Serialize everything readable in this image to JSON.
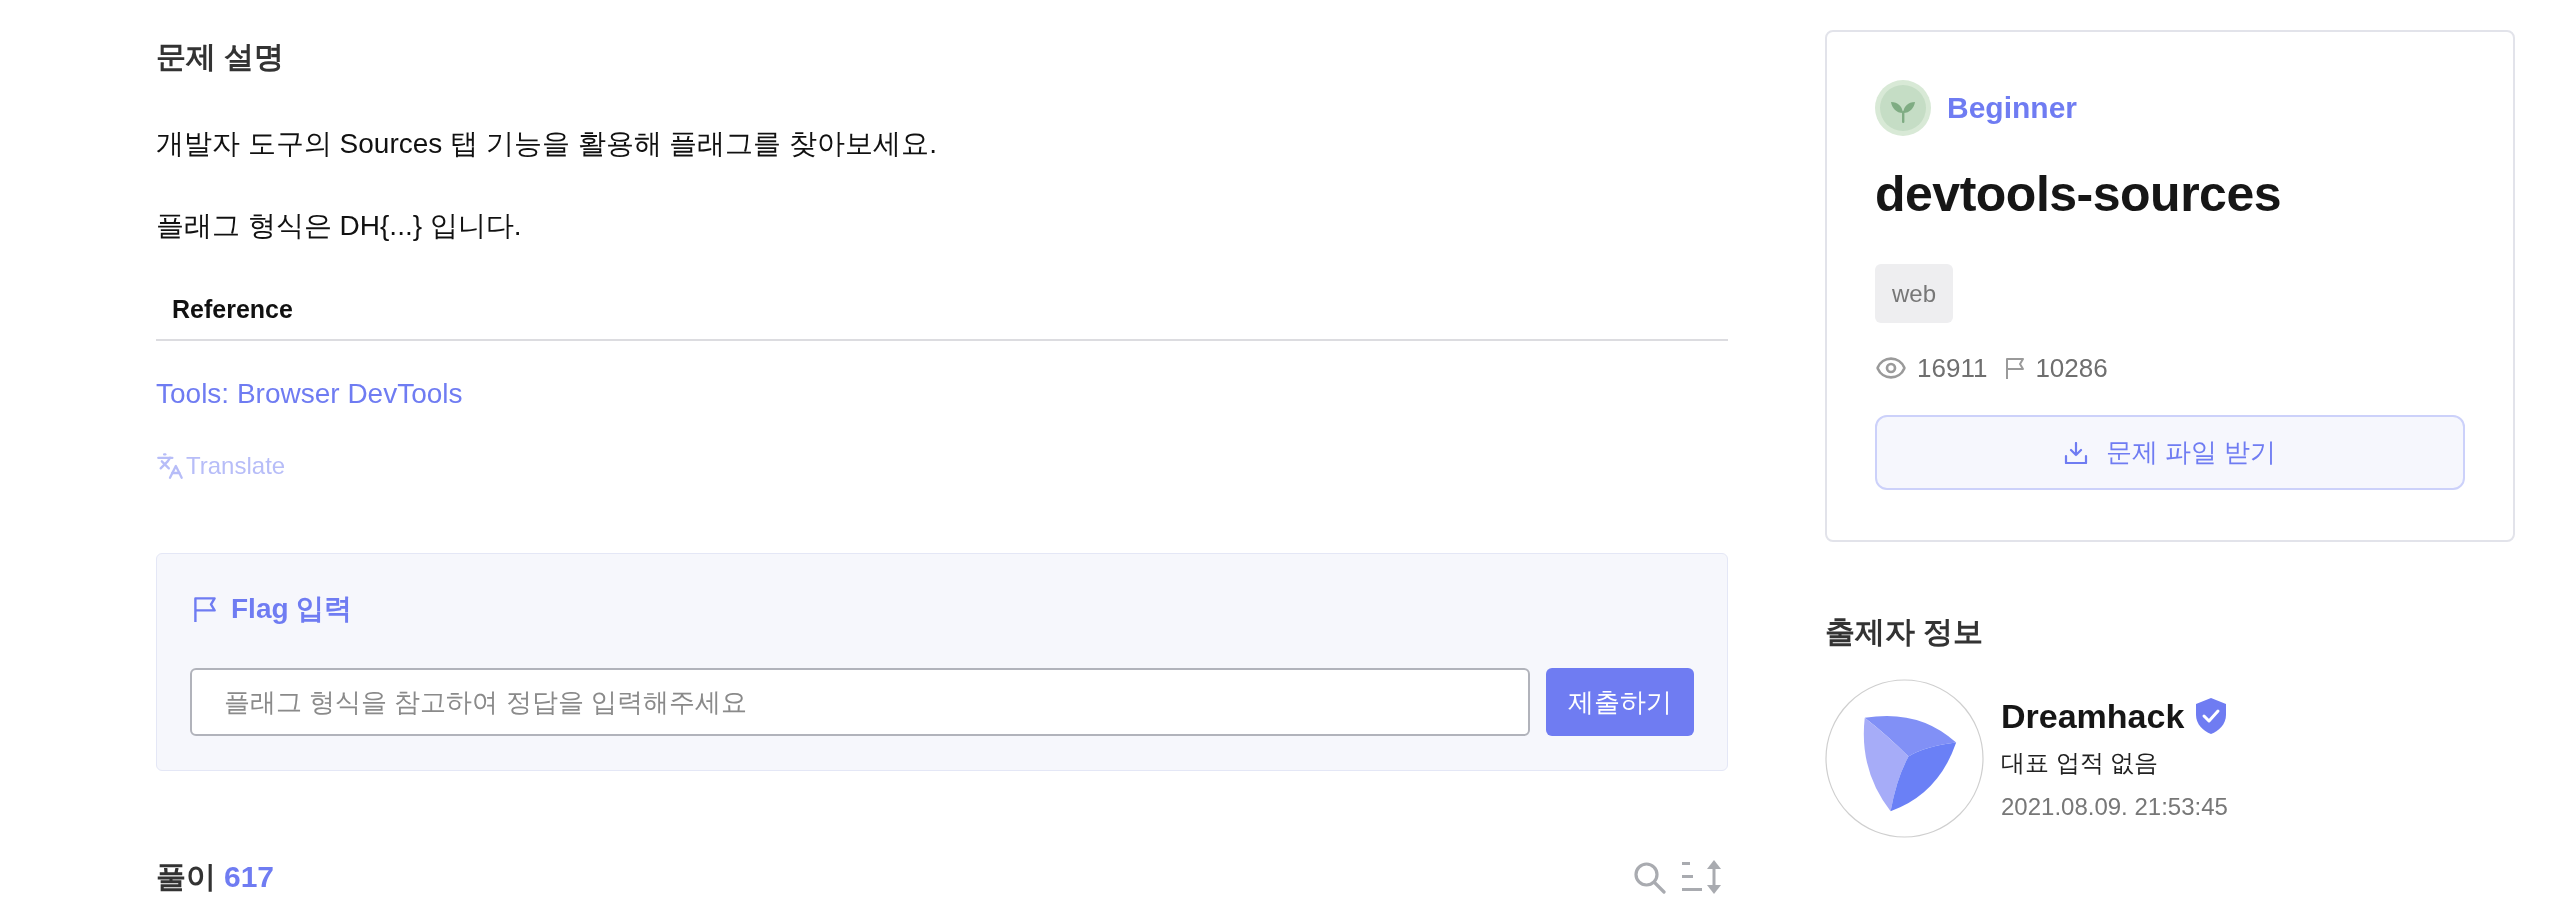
{
  "description": {
    "heading": "문제 설명",
    "paragraphs": [
      "개발자 도구의 Sources 탭 기능을 활용해 플래그를 찾아보세요.",
      "플래그 형식은 DH{...} 입니다."
    ],
    "reference": {
      "heading": "Reference",
      "links": [
        "Tools: Browser DevTools"
      ]
    },
    "translate": "Translate"
  },
  "flag_input": {
    "title": "Flag 입력",
    "placeholder": "플래그 형식을 참고하여 정답을 입력해주세요",
    "submit": "제출하기"
  },
  "solutions": {
    "label": "풀이",
    "count": "617"
  },
  "challenge": {
    "level": "Beginner",
    "title": "devtools-sources",
    "tags": [
      "web"
    ],
    "views": "16911",
    "solves": "10286",
    "download": "문제 파일 받기"
  },
  "author": {
    "heading": "출제자 정보",
    "name": "Dreamhack",
    "verified": true,
    "achievement": "대표 업적 없음",
    "date": "2021.08.09. 21:53:45"
  }
}
